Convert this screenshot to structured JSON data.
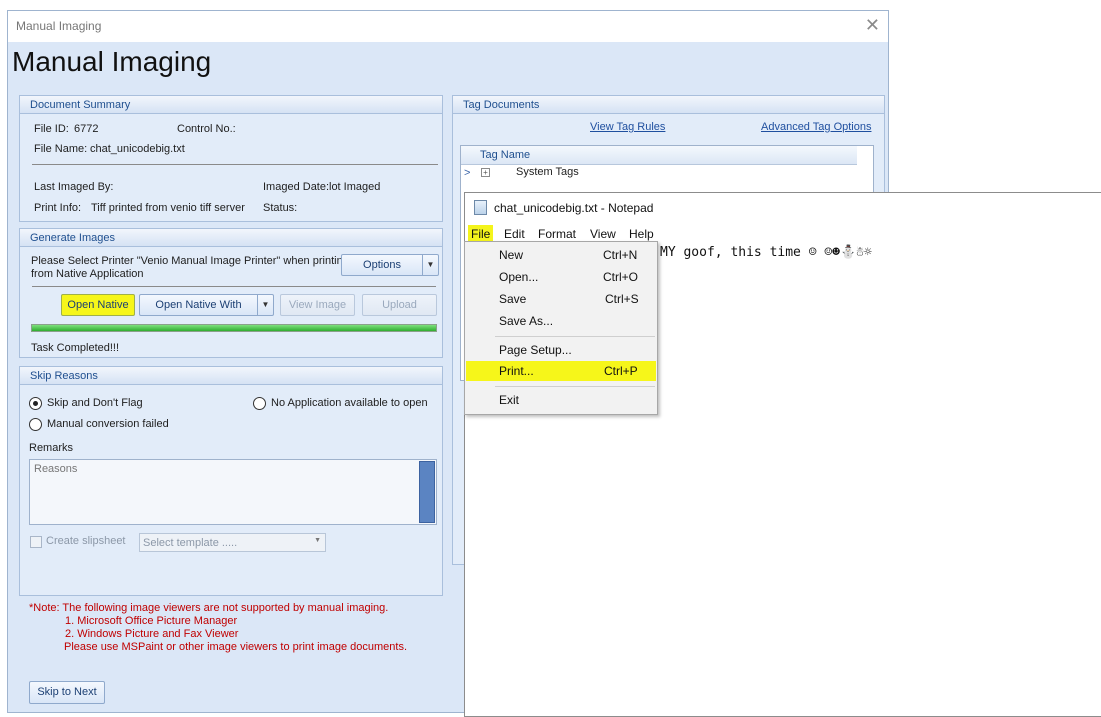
{
  "window": {
    "title": "Manual Imaging",
    "heading": "Manual Imaging",
    "close_glyph": "✕"
  },
  "document_summary": {
    "header": "Document Summary",
    "file_id_label": "File ID:",
    "file_id": "6772",
    "control_no_label": "Control No.:",
    "file_name_label": "File Name:",
    "file_name": "chat_unicodebig.txt",
    "last_imaged_by_label": "Last Imaged By:",
    "imaged_date_label": "Imaged Date:",
    "imaged_date": "lot Imaged",
    "print_info_label": "Print Info:",
    "print_info": "Tiff printed from venio tiff server",
    "status_label": "Status:"
  },
  "generate_images": {
    "header": "Generate Images",
    "instruction_line1": "Please Select Printer \"Venio Manual Image Printer\" when printing",
    "instruction_line2": "from Native Application",
    "options_button": "Options",
    "open_native": "Open Native",
    "open_native_with": "Open Native With",
    "view_image": "View Image",
    "upload": "Upload",
    "progress": 1.0,
    "status": "Task Completed!!!"
  },
  "skip_reasons": {
    "header": "Skip Reasons",
    "option_skip_no_flag": "Skip and Don't Flag",
    "option_no_app": "No Application available to open",
    "option_conversion_failed": "Manual conversion failed",
    "remarks_label": "Remarks",
    "reasons_placeholder": "Reasons",
    "create_slipsheet": "Create slipsheet",
    "template_placeholder": "Select template .....",
    "selected_option": "Skip and Don't Flag"
  },
  "note": {
    "line1": "*Note: The following image viewers are not supported by manual imaging.",
    "line2": "1. Microsoft Office Picture Manager",
    "line3": "2. Windows Picture and Fax Viewer",
    "line4": "Please use MSPaint or other image viewers to print image documents."
  },
  "skip_to_next": "Skip to Next",
  "tag_documents": {
    "header": "Tag Documents",
    "view_tag_rules": "View Tag Rules",
    "advanced_tag_options": "Advanced Tag Options",
    "column_tag_name": "Tag Name",
    "rows": [
      "System Tags"
    ]
  },
  "notepad": {
    "title": "chat_unicodebig.txt - Notepad",
    "menus": [
      "File",
      "Edit",
      "Format",
      "View",
      "Help"
    ],
    "content": "MY goof, this time ☺ ☺☻⛄☃☼",
    "file_menu": {
      "new": "New",
      "new_shortcut": "Ctrl+N",
      "open": "Open...",
      "open_shortcut": "Ctrl+O",
      "save": "Save",
      "save_shortcut": "Ctrl+S",
      "save_as": "Save As...",
      "page_setup": "Page Setup...",
      "print": "Print...",
      "print_shortcut": "Ctrl+P",
      "exit": "Exit"
    }
  },
  "colors": {
    "highlight": "#f6f61a",
    "dialog_bg": "#dbe7f7",
    "note_red": "#c00000",
    "progress_green": "#3cbf3c"
  }
}
